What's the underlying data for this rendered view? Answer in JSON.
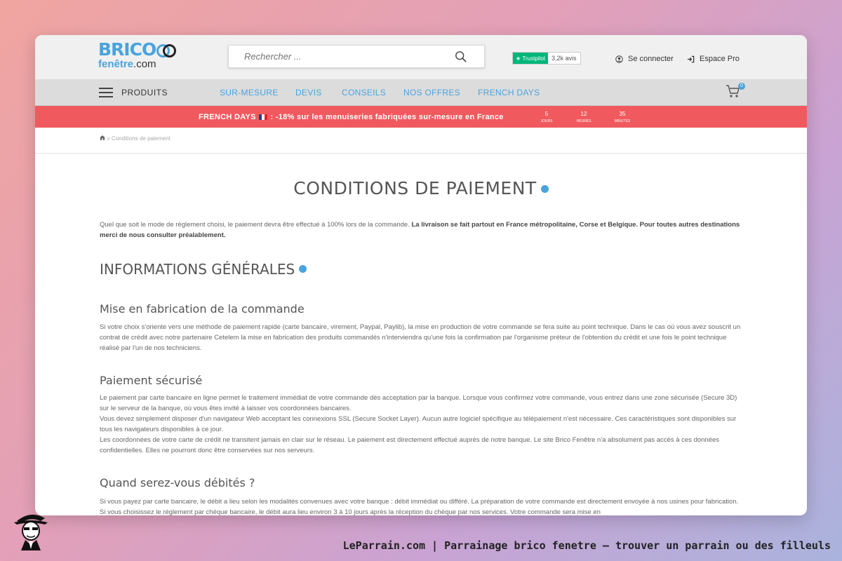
{
  "header": {
    "logo_top": "BRICO",
    "logo_bottom_a": "fenêtre",
    "logo_bottom_b": ".com",
    "search_placeholder": "Rechercher ...",
    "trustpilot_label": "Trustpilot",
    "trustpilot_count": "3,2k avis",
    "login_label": "Se connecter",
    "pro_label": "Espace Pro"
  },
  "nav": {
    "menu_label": "PRODUITS",
    "links": [
      "SUR-MESURE",
      "DEVIS",
      "CONSEILS",
      "NOS OFFRES",
      "FRENCH DAYS"
    ],
    "cart_count": "0"
  },
  "promo": {
    "text_a": "FRENCH DAYS",
    "text_b": ": -18% sur les menuiseries fabriquées sur-mesure en France",
    "countdown": [
      {
        "value": "5",
        "unit": "JOURS"
      },
      {
        "value": "12",
        "unit": "HEURES"
      },
      {
        "value": "35",
        "unit": "MINUTES"
      }
    ]
  },
  "breadcrumb": {
    "separator": "»",
    "current": "Conditions de paiement"
  },
  "page": {
    "title": "CONDITIONS DE PAIEMENT",
    "intro_normal": "Quel que soit le mode de règlement choisi, le paiement devra être effectué à 100% lors de la commande. ",
    "intro_bold": "La livraison se fait partout en France métropolitaine, Corse et Belgique. Pour toutes autres destinations merci de nous consulter préalablement.",
    "section_title": "INFORMATIONS GÉNÉRALES",
    "s1_title": "Mise en fabrication de la commande",
    "s1_text": "Si votre choix s'oriente vers une méthode de paiement rapide (carte bancaire, virement, Paypal, Paylib), la mise en production de votre commande se fera suite au point technique. Dans le cas où vous avez souscrit un contrat de crédit avec notre partenaire Cetelem la mise en fabrication des produits commandés n'interviendra qu'une fois la confirmation par l'organisme préteur de l'obtention du crédit et une fois le point technique réalisé par l'un de nos techniciens.",
    "s2_title": "Paiement sécurisé",
    "s2_p1": "Le paiement par carte bancaire en ligne permet le traitement immédiat de votre commande dès acceptation par la banque. Lorsque vous confirmez votre commande, vous entrez dans une zone sécurisée (Secure 3D) sur le serveur de la banque, où vous êtes invité à laisser vos coordonnées bancaires.",
    "s2_p2": "Vous devez simplement disposer d'un navigateur Web acceptant les connexions SSL (Secure Socket Layer). Aucun autre logiciel spécifique au télépaiement n'est nécessaire. Ces caractéristiques sont disponibles sur tous les navigateurs disponibles à ce jour.",
    "s2_p3": "Les coordonnées de votre carte de crédit ne transitent jamais en clair sur le réseau. Le paiement est directement effectué auprès de notre banque. Le site Brico Fenêtre n'a absolument pas accès à ces données confidentielles. Elles ne pourront donc être conservées sur nos serveurs.",
    "s3_title": "Quand serez-vous débités ?",
    "s3_text": "Si vous payez par carte bancaire, le débit a lieu selon les modalités convenues avec votre banque : débit immédiat ou différé. La préparation de votre commande est directement envoyée à nos usines pour fabrication. Si vous choisissez le règlement par chèque bancaire, le débit aura lieu environ 3 à 10 jours après la réception du chèque par nos services. Votre commande sera mise en"
  },
  "caption": "LeParrain.com | Parrainage brico fenetre — trouver un parrain ou des filleuls",
  "colors": {
    "accent": "#4aa3dc",
    "promo": "#f05a5f",
    "trustpilot": "#00b67a"
  }
}
